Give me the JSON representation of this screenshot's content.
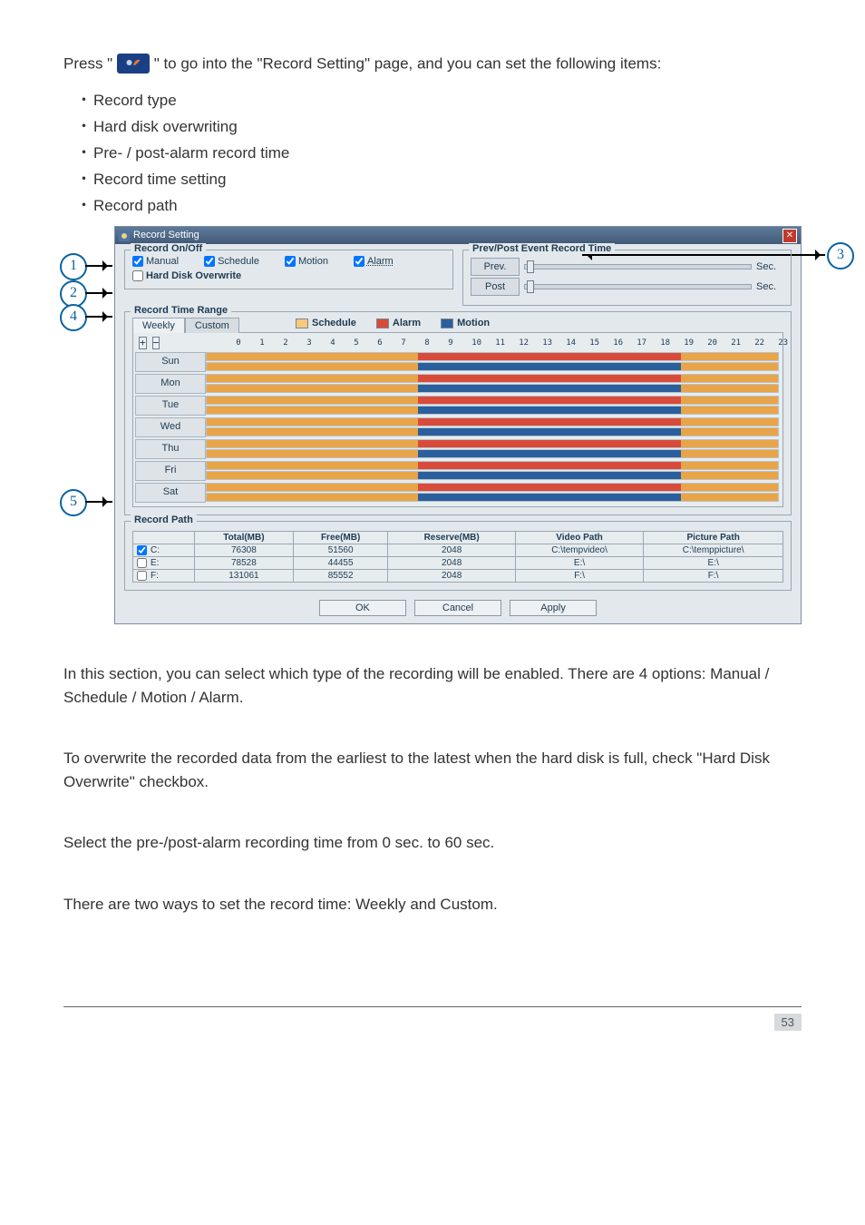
{
  "intro": {
    "pre": "Press \"",
    "post": "\" to go into the \"Record Setting\" page, and you can set the following items:"
  },
  "items": [
    "Record type",
    "Hard disk overwriting",
    "Pre- / post-alarm record time",
    "Record time setting",
    "Record path"
  ],
  "callouts": {
    "c1": "1",
    "c2": "2",
    "c3": "3",
    "c4": "4",
    "c5": "5"
  },
  "window": {
    "title": "Record Setting",
    "onoff": {
      "legend": "Record On/Off",
      "manual": "Manual",
      "schedule": "Schedule",
      "motion": "Motion",
      "alarm": "Alarm"
    },
    "prepost": {
      "legend": "Prev/Post Event Record Time",
      "prev": "Prev.",
      "post": "Post",
      "sec": "Sec."
    },
    "hdoverwrite": "Hard Disk Overwrite",
    "range": {
      "legend": "Record Time Range",
      "weekly": "Weekly",
      "custom": "Custom",
      "legend_schedule": "Schedule",
      "legend_alarm": "Alarm",
      "legend_motion": "Motion",
      "days": [
        "Sun",
        "Mon",
        "Tue",
        "Wed",
        "Thu",
        "Fri",
        "Sat"
      ],
      "hours": [
        "0",
        "1",
        "2",
        "3",
        "4",
        "5",
        "6",
        "7",
        "8",
        "9",
        "10",
        "11",
        "12",
        "13",
        "14",
        "15",
        "16",
        "17",
        "18",
        "19",
        "20",
        "21",
        "22",
        "23"
      ]
    },
    "path": {
      "legend": "Record Path",
      "headers": [
        "",
        "Total(MB)",
        "Free(MB)",
        "Reserve(MB)",
        "Video Path",
        "Picture Path"
      ],
      "rows": [
        {
          "checked": true,
          "drive": "C:",
          "total": "76308",
          "free": "51560",
          "reserve": "2048",
          "video": "C:\\tempvideo\\",
          "picture": "C:\\temppicture\\"
        },
        {
          "checked": false,
          "drive": "E:",
          "total": "78528",
          "free": "44455",
          "reserve": "2048",
          "video": "E:\\",
          "picture": "E:\\"
        },
        {
          "checked": false,
          "drive": "F:",
          "total": "131061",
          "free": "85552",
          "reserve": "2048",
          "video": "F:\\",
          "picture": "F:\\"
        }
      ]
    },
    "buttons": {
      "ok": "OK",
      "cancel": "Cancel",
      "apply": "Apply"
    }
  },
  "paragraphs": {
    "p1": "In this section, you can select which type of the recording will be enabled. There are 4 options: Manual / Schedule / Motion / Alarm.",
    "p2": "To overwrite the recorded data from the earliest to the latest when the hard disk is full, check \"Hard Disk Overwrite\" checkbox.",
    "p3": "Select the pre-/post-alarm recording time from 0 sec. to 60 sec.",
    "p4": "There are two ways to set the record time: Weekly and Custom."
  },
  "page_number": "53"
}
